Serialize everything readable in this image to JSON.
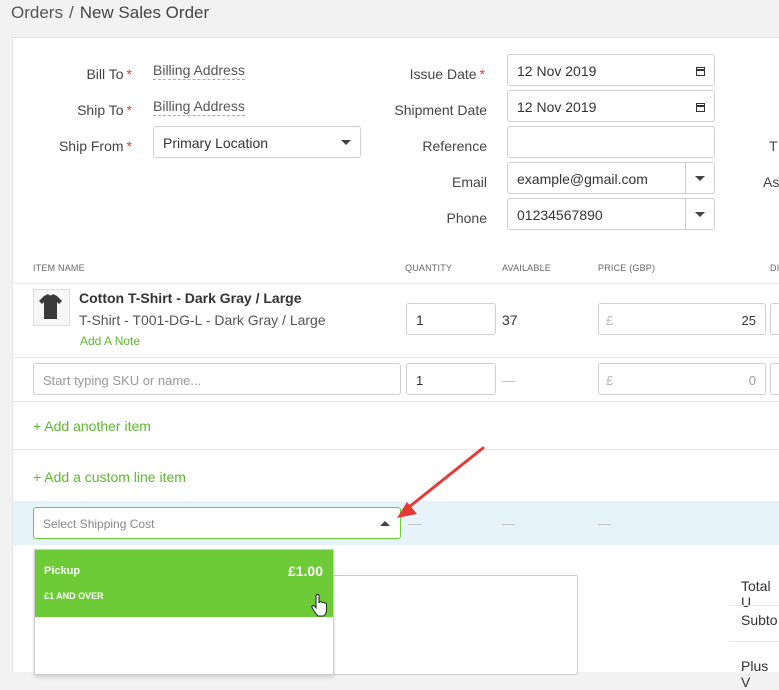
{
  "breadcrumb": {
    "parent": "Orders",
    "separator": "/",
    "current": "New Sales Order"
  },
  "form": {
    "bill_to": {
      "label": "Bill To",
      "value": "Billing Address"
    },
    "ship_to": {
      "label": "Ship To",
      "value": "Billing Address"
    },
    "ship_from": {
      "label": "Ship From",
      "value": "Primary Location"
    },
    "issue_date": {
      "label": "Issue Date",
      "value": "12 Nov 2019"
    },
    "shipment_date": {
      "label": "Shipment Date",
      "value": "12 Nov 2019"
    },
    "reference": {
      "label": "Reference",
      "value": ""
    },
    "email": {
      "label": "Email",
      "value": "example@gmail.com"
    },
    "phone": {
      "label": "Phone",
      "value": "01234567890"
    },
    "right_cut_1": "T",
    "right_cut_2": "As",
    "required_mark": "*"
  },
  "table": {
    "headers": {
      "item_name": "ITEM NAME",
      "quantity": "QUANTITY",
      "available": "AVAILABLE",
      "price": "PRICE (GBP)",
      "cut": "DI"
    },
    "rows": [
      {
        "name": "Cotton T-Shirt - Dark Gray / Large",
        "variant": "T-Shirt - T001-DG-L - Dark Gray / Large",
        "note_link": "Add A Note",
        "quantity": "1",
        "available": "37",
        "currency": "£",
        "price": "25"
      }
    ],
    "new_row": {
      "placeholder": "Start typing SKU or name...",
      "quantity": "1",
      "available": "—",
      "currency": "£",
      "price": "0"
    },
    "add_item": "+ Add another item",
    "add_custom": "+ Add a custom line item",
    "shipping": {
      "placeholder": "Select Shipping Cost",
      "dashes": [
        "—",
        "—",
        "—"
      ]
    }
  },
  "shipping_dropdown": {
    "options": [
      {
        "name": "Pickup",
        "price": "£1.00",
        "condition": "£1 AND OVER"
      }
    ]
  },
  "totals": {
    "total_units": "Total U",
    "subtotal": "Subto",
    "plus": "Plus V"
  },
  "colors": {
    "accent": "#5cb82d",
    "selected_option": "#6ccb36",
    "arrow": "#e53935",
    "required": "#e53935",
    "shipping_row": "#e6f3fb"
  }
}
